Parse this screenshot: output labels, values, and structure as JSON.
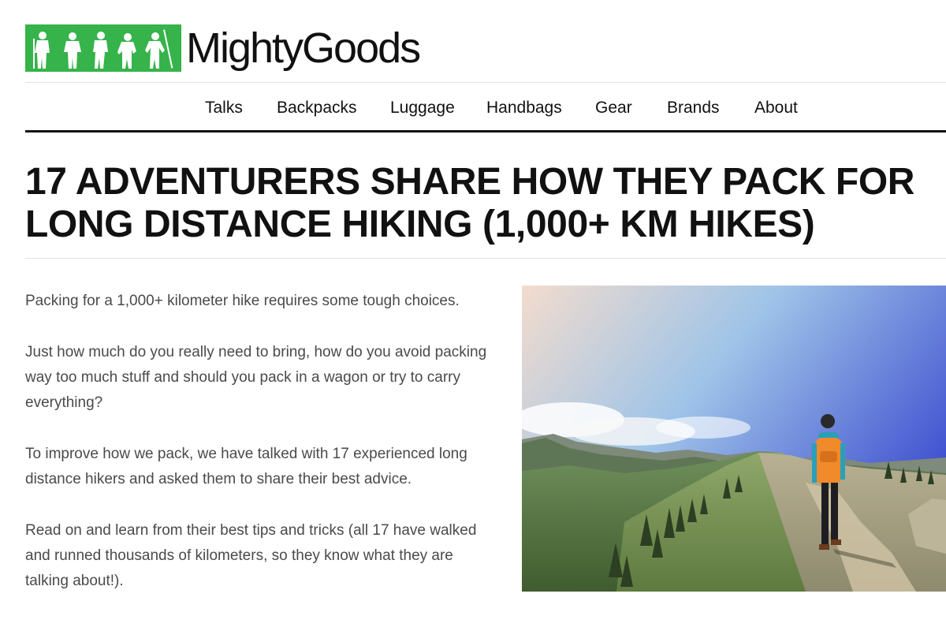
{
  "brand": {
    "name": "MightyGoods",
    "logo_color": "#36b34a"
  },
  "nav": {
    "items": [
      "Talks",
      "Backpacks",
      "Luggage",
      "Handbags",
      "Gear",
      "Brands",
      "About"
    ]
  },
  "article": {
    "title": "17 ADVENTURERS SHARE HOW THEY PACK FOR LONG DISTANCE HIKING (1,000+ KM HIKES)",
    "paragraphs": [
      "Packing for a 1,000+ kilometer hike requires some tough choices.",
      "Just how much do you really need to bring, how do you avoid packing way too much stuff and should you pack in a wagon or try to carry everything?",
      "To improve how we pack, we have talked with 17 experienced long distance hikers and asked them to share their best advice.",
      "Read on and learn from their best tips and tricks (all 17 have walked and runned thousands of kilometers, so they know what they are talking about!)."
    ],
    "hero_image": "hiker-on-mountain-ridge-photo"
  }
}
